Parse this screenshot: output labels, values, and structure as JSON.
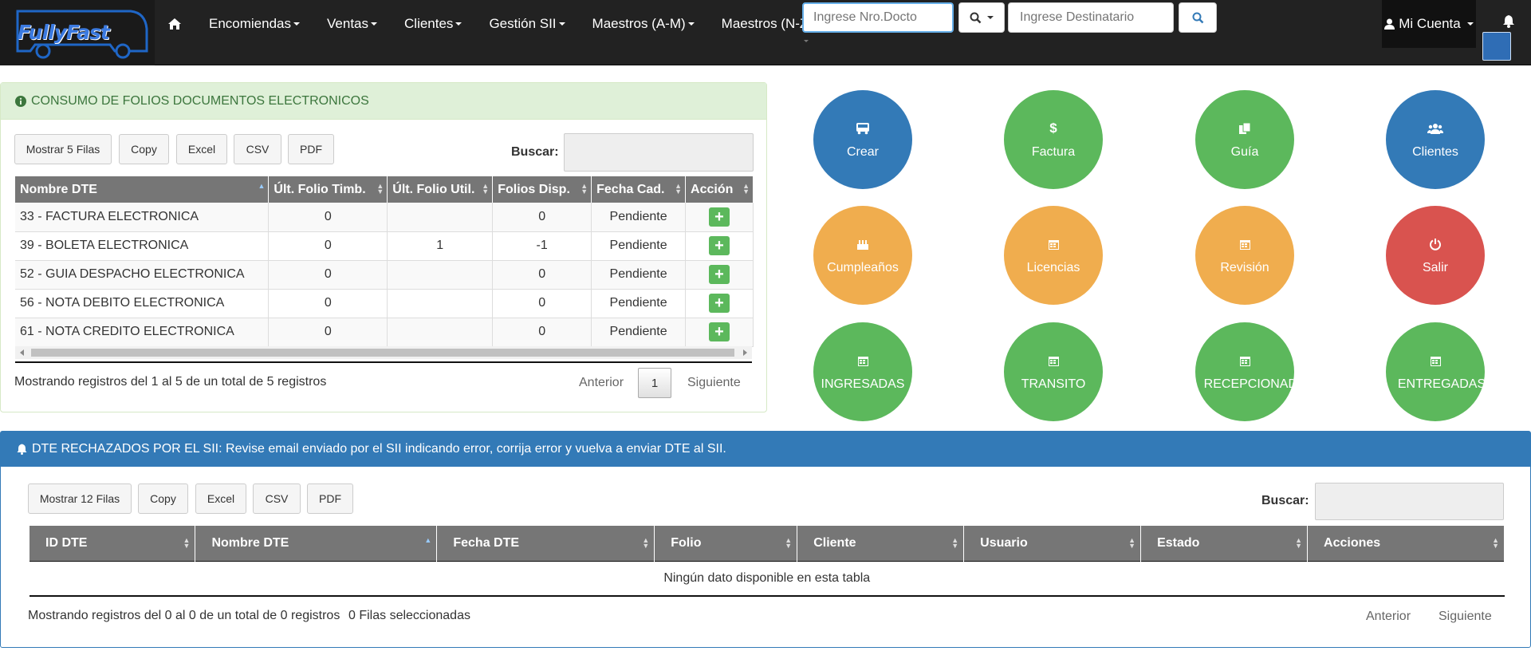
{
  "nav": {
    "brand": "FullyFast",
    "menu": [
      "Encomiendas",
      "Ventas",
      "Clientes",
      "Gestión SII",
      "Maestros (A-M)",
      "Maestros (N-Z)"
    ],
    "search_docto_placeholder": "Ingrese Nro.Docto",
    "search_dest_placeholder": "Ingrese Destinatario",
    "account": "Mi Cuenta"
  },
  "folios": {
    "title": "CONSUMO DE FOLIOS DOCUMENTOS ELECTRONICOS",
    "buttons": [
      "Mostrar 5 Filas",
      "Copy",
      "Excel",
      "CSV",
      "PDF"
    ],
    "search_label": "Buscar:",
    "columns": [
      "Nombre DTE",
      "Últ. Folio Timb.",
      "Últ. Folio Util.",
      "Folios Disp.",
      "Fecha Cad.",
      "Acción"
    ],
    "rows": [
      {
        "nombre": "33 - FACTURA ELECTRONICA",
        "timb": "0",
        "util": "",
        "disp": "0",
        "fecha": "Pendiente"
      },
      {
        "nombre": "39 - BOLETA ELECTRONICA",
        "timb": "0",
        "util": "1",
        "disp": "-1",
        "fecha": "Pendiente"
      },
      {
        "nombre": "52 - GUIA DESPACHO ELECTRONICA",
        "timb": "0",
        "util": "",
        "disp": "0",
        "fecha": "Pendiente"
      },
      {
        "nombre": "56 - NOTA DEBITO ELECTRONICA",
        "timb": "0",
        "util": "",
        "disp": "0",
        "fecha": "Pendiente"
      },
      {
        "nombre": "61 - NOTA CREDITO ELECTRONICA",
        "timb": "0",
        "util": "",
        "disp": "0",
        "fecha": "Pendiente"
      }
    ],
    "info": "Mostrando registros del 1 al 5 de un total de 5 registros",
    "prev": "Anterior",
    "page": "1",
    "next": "Siguiente"
  },
  "shortcuts": [
    {
      "label": "Crear",
      "color": "blue",
      "icon": "bus-icon"
    },
    {
      "label": "Factura",
      "color": "green",
      "icon": "dollar-icon"
    },
    {
      "label": "Guía",
      "color": "green",
      "icon": "copy-icon"
    },
    {
      "label": "Clientes",
      "color": "blue",
      "icon": "users-icon"
    },
    {
      "label": "Cumpleaños",
      "color": "orange",
      "icon": "cake-icon"
    },
    {
      "label": "Licencias",
      "color": "orange",
      "icon": "calendar-icon"
    },
    {
      "label": "Revisión",
      "color": "orange",
      "icon": "calendar-icon"
    },
    {
      "label": "Salir",
      "color": "red",
      "icon": "power-icon"
    },
    {
      "label": "INGRESADAS",
      "color": "green",
      "icon": "calendar-icon"
    },
    {
      "label": "TRANSITO",
      "color": "green",
      "icon": "calendar-icon"
    },
    {
      "label": "RECEPCIONADAS",
      "color": "green",
      "icon": "calendar-icon"
    },
    {
      "label": "ENTREGADAS",
      "color": "green",
      "icon": "calendar-icon"
    }
  ],
  "rechazados": {
    "title": "DTE RECHAZADOS POR EL SII: Revise email enviado por el SII indicando error, corrija error y vuelva a enviar DTE al SII.",
    "buttons": [
      "Mostrar 12 Filas",
      "Copy",
      "Excel",
      "CSV",
      "PDF"
    ],
    "search_label": "Buscar:",
    "columns": [
      "ID DTE",
      "Nombre DTE",
      "Fecha DTE",
      "Folio",
      "Cliente",
      "Usuario",
      "Estado",
      "Acciones"
    ],
    "empty": "Ningún dato disponible en esta tabla",
    "info": "Mostrando registros del 0 al 0 de un total de 0 registros",
    "selected": "0 Filas seleccionadas",
    "prev": "Anterior",
    "next": "Siguiente"
  },
  "colors": {
    "blue": "#337ab7",
    "green": "#5cb85c",
    "orange": "#f0ad4e",
    "red": "#d9534f"
  }
}
